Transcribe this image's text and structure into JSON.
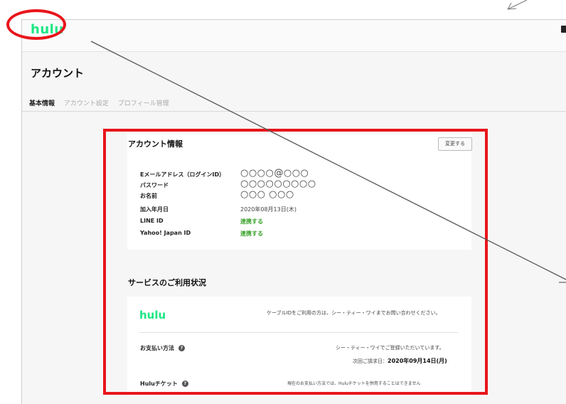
{
  "app": {
    "logo": "hulu"
  },
  "page": {
    "title": "アカウント"
  },
  "tabs": [
    {
      "label": "基本情報",
      "active": true
    },
    {
      "label": "アカウント設定",
      "active": false
    },
    {
      "label": "プロフィール管理",
      "active": false
    }
  ],
  "account_info": {
    "title": "アカウント情報",
    "change_button": "変更する",
    "fields": [
      {
        "label": "Eメールアドレス（ログインID）",
        "value": "○○○○@○○○"
      },
      {
        "label": "パスワード",
        "value": "○○○○○○○○○"
      },
      {
        "label": "お名前",
        "value": "○○○ ○○○"
      },
      {
        "label": "加入年月日",
        "value": "2020年08月13日(木)"
      },
      {
        "label": "LINE ID",
        "value": "連携する"
      },
      {
        "label": "Yahoo! Japan ID",
        "value": "連携する"
      }
    ]
  },
  "service": {
    "title": "サービスのご利用状況",
    "logo": "hulu",
    "note": "ケーブルIDをご利用の方は、シー・ティー・ワイまでお問い合わせください。",
    "payment_label": "お支払い方法",
    "payment_value": "シー・ティー・ワイでご登録いただいています。",
    "next_bill_label": "次回ご請求日：",
    "next_bill_date": "2020年09月14日(月)",
    "ticket_label": "Huluチケット",
    "ticket_note": "現在のお支払い方法では、Huluチケットを併用することはできません"
  },
  "colors": {
    "brand": "#1ce783",
    "annotation": "#e8151b",
    "link": "#3aa12a"
  }
}
